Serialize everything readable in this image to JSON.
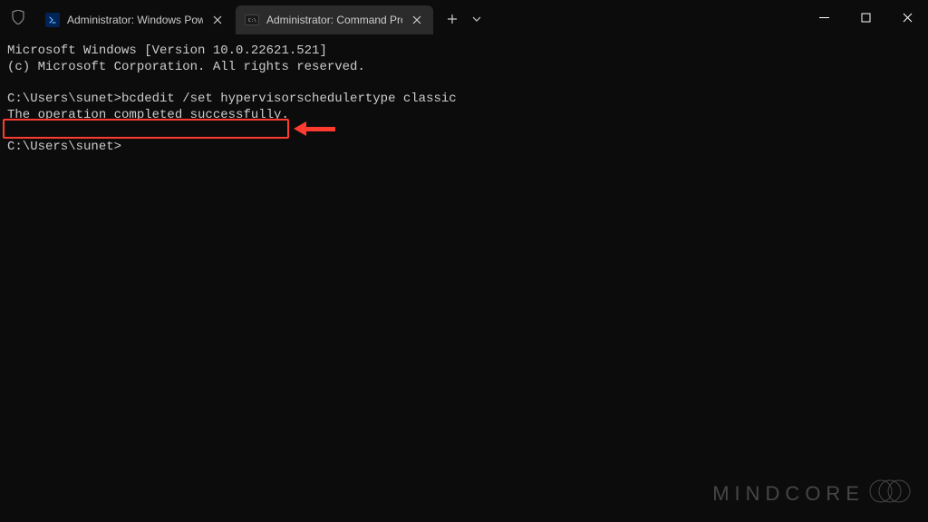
{
  "tabs": [
    {
      "title": "Administrator: Windows Powe"
    },
    {
      "title": "Administrator: Command Pro"
    }
  ],
  "terminal": {
    "line1": "Microsoft Windows [Version 10.0.22621.521]",
    "line2": "(c) Microsoft Corporation. All rights reserved.",
    "line3": "C:\\Users\\sunet>bcdedit /set hypervisorschedulertype classic",
    "line4": "The operation completed successfully.",
    "line5": "C:\\Users\\sunet>"
  },
  "watermark": "MINDCORE"
}
